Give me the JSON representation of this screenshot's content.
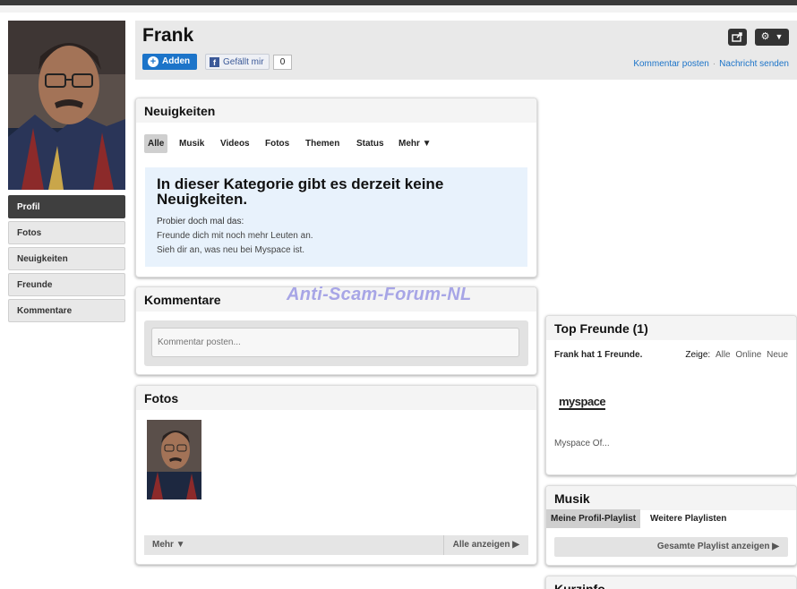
{
  "profile": {
    "name": "Frank",
    "add_label": "Adden",
    "like_label": "Gefällt mir",
    "like_count": "0",
    "share_icon": "share-icon",
    "settings_icon": "gear-icon",
    "settings_caret": "▼",
    "links": [
      "Kommentar posten",
      "Nachricht senden"
    ]
  },
  "sidebar": {
    "items": [
      {
        "label": "Profil",
        "active": true
      },
      {
        "label": "Fotos"
      },
      {
        "label": "Neuigkeiten"
      },
      {
        "label": "Freunde"
      },
      {
        "label": "Kommentare"
      }
    ]
  },
  "news": {
    "title": "Neuigkeiten",
    "tabs": [
      "Alle",
      "Musik",
      "Videos",
      "Fotos",
      "Themen",
      "Status",
      "Mehr ▼"
    ],
    "empty_title": "In dieser Kategorie gibt es derzeit keine Neuigkeiten.",
    "hint": "Probier doch mal das:",
    "suggestions": [
      "Freunde dich mit noch mehr Leuten an.",
      "Sieh dir an, was neu bei Myspace ist."
    ]
  },
  "comments": {
    "title": "Kommentare",
    "placeholder": "Kommentar posten..."
  },
  "watermark": "Anti-Scam-Forum-NL",
  "photos": {
    "title": "Fotos",
    "more": "Mehr ▼",
    "view_all": "Alle anzeigen ▶"
  },
  "top_friends": {
    "title": "Top Freunde (1)",
    "count_text": "Frank hat 1 Freunde.",
    "show_label": "Zeige:",
    "filters": [
      "Alle",
      "Online",
      "Neue"
    ],
    "logo_text": "myspace",
    "friend_name": "Myspace Of..."
  },
  "music": {
    "title": "Musik",
    "tabs": [
      "Meine Profil-Playlist",
      "Weitere Playlisten"
    ],
    "button": "Gesamte Playlist anzeigen ▶"
  },
  "kurzinfo": {
    "title": "Kurzinfo"
  },
  "colors": {
    "accent": "#1c74c9",
    "facebook": "#3b5998",
    "news_empty_bg": "#e8f2fc",
    "nav_active": "#3f3f3f",
    "watermark": "#a7a5e6"
  }
}
